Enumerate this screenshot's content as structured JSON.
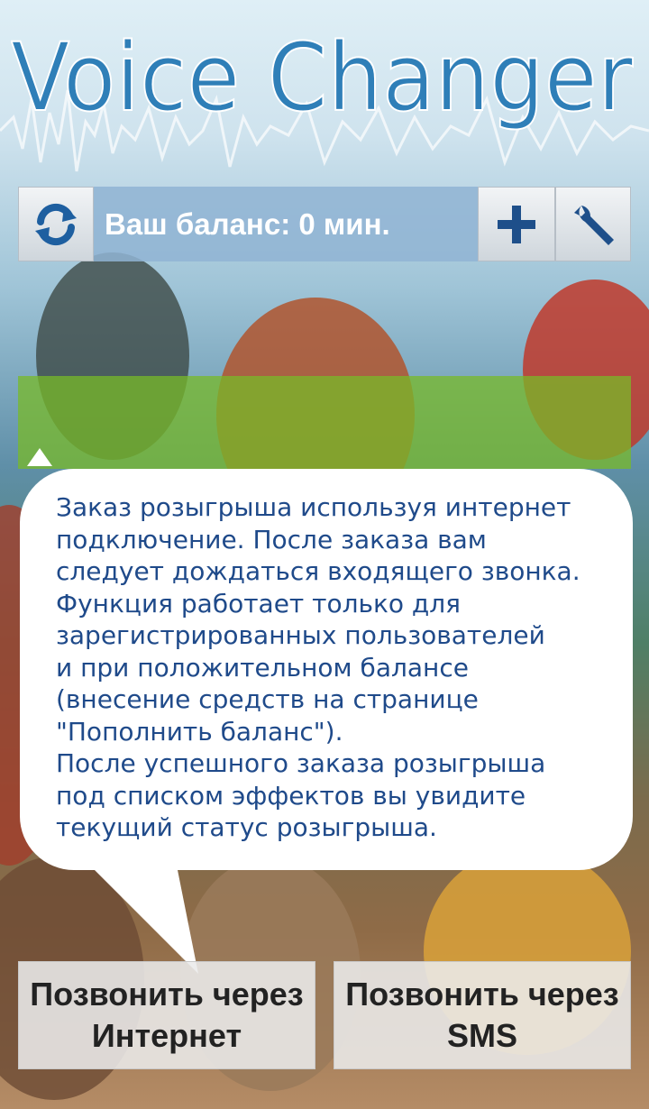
{
  "app": {
    "title": "Voice Changer"
  },
  "toolbar": {
    "refresh_icon": "refresh-icon",
    "balance_text": "Ваш баланс: 0 мин.",
    "add_icon": "plus-icon",
    "settings_icon": "wrench-icon"
  },
  "info_bubble": {
    "text": "Заказ розыгрыша используя интернет\nподключение. После заказа вам\nследует дождаться входящего звонка.\nФункция работает только для\nзарегистрированных пользователей\nи при положительном балансе\n(внесение средств на странице\n\"Пополнить баланс\").\nПосле успешного заказа розыгрыша\nпод списком эффектов вы увидите\nтекущий статус розыгрыша."
  },
  "actions": {
    "call_internet_line1": "Позвонить через",
    "call_internet_line2": "Интернет",
    "call_sms_line1": "Позвонить через",
    "call_sms_line2": "SMS"
  },
  "colors": {
    "balance_bg": "#91b4d4",
    "info_text": "#1f4a8a",
    "green_strip": "#78ba28",
    "title_blue": "#2f7fb8"
  }
}
